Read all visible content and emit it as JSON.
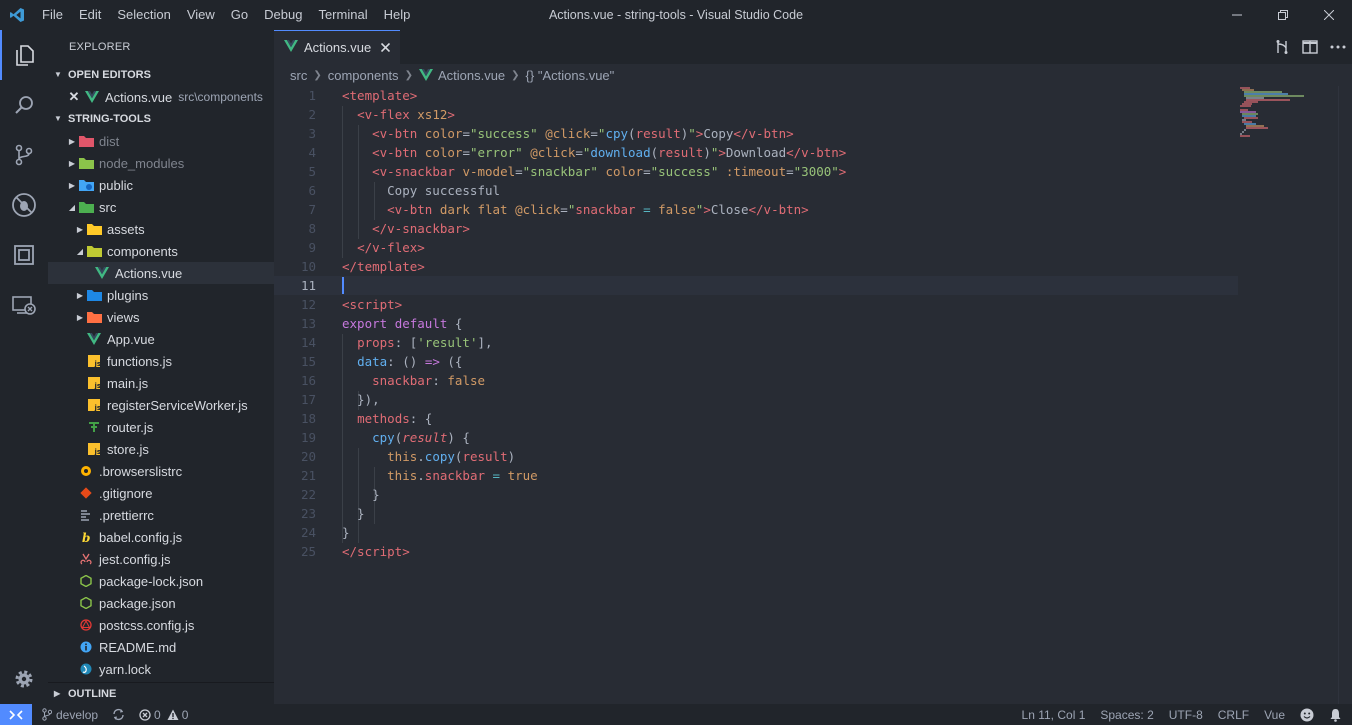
{
  "window": {
    "title": "Actions.vue - string-tools - Visual Studio Code",
    "menu": [
      "File",
      "Edit",
      "Selection",
      "View",
      "Go",
      "Debug",
      "Terminal",
      "Help"
    ]
  },
  "activity_bar": {
    "items": [
      "files-icon",
      "search-icon",
      "source-control-icon",
      "debug-icon",
      "extensions-icon",
      "remote-explorer-icon"
    ],
    "bottom": "gear-icon",
    "accent": "#528bff"
  },
  "sidebar": {
    "title": "EXPLORER",
    "open_editors_label": "OPEN EDITORS",
    "open_editor": {
      "name": "Actions.vue",
      "path": "src\\components"
    },
    "project_label": "STRING-TOOLS",
    "tree": [
      {
        "name": "dist"
      },
      {
        "name": "node_modules"
      },
      {
        "name": "public"
      },
      {
        "name": "src"
      },
      {
        "name": "assets"
      },
      {
        "name": "components"
      },
      {
        "name": "Actions.vue"
      },
      {
        "name": "plugins"
      },
      {
        "name": "views"
      },
      {
        "name": "App.vue"
      },
      {
        "name": "functions.js"
      },
      {
        "name": "main.js"
      },
      {
        "name": "registerServiceWorker.js"
      },
      {
        "name": "router.js"
      },
      {
        "name": "store.js"
      },
      {
        "name": ".browserslistrc"
      },
      {
        "name": ".gitignore"
      },
      {
        "name": ".prettierrc"
      },
      {
        "name": "babel.config.js"
      },
      {
        "name": "jest.config.js"
      },
      {
        "name": "package-lock.json"
      },
      {
        "name": "package.json"
      },
      {
        "name": "postcss.config.js"
      },
      {
        "name": "README.md"
      },
      {
        "name": "yarn.lock"
      }
    ],
    "outline_label": "OUTLINE"
  },
  "editor": {
    "tab_label": "Actions.vue",
    "breadcrumb": [
      "src",
      "components",
      "Actions.vue",
      "{} \"Actions.vue\""
    ],
    "line_numbers": [
      "1",
      "2",
      "3",
      "4",
      "5",
      "6",
      "7",
      "8",
      "9",
      "10",
      "11",
      "12",
      "13",
      "14",
      "15",
      "16",
      "17",
      "18",
      "19",
      "20",
      "21",
      "22",
      "23",
      "24",
      "25"
    ],
    "current_line": 11
  },
  "status_bar": {
    "branch": "develop",
    "errors": "0",
    "warnings": "0",
    "position": "Ln 11, Col 1",
    "spaces": "Spaces: 2",
    "encoding": "UTF-8",
    "eol": "CRLF",
    "language": "Vue"
  }
}
